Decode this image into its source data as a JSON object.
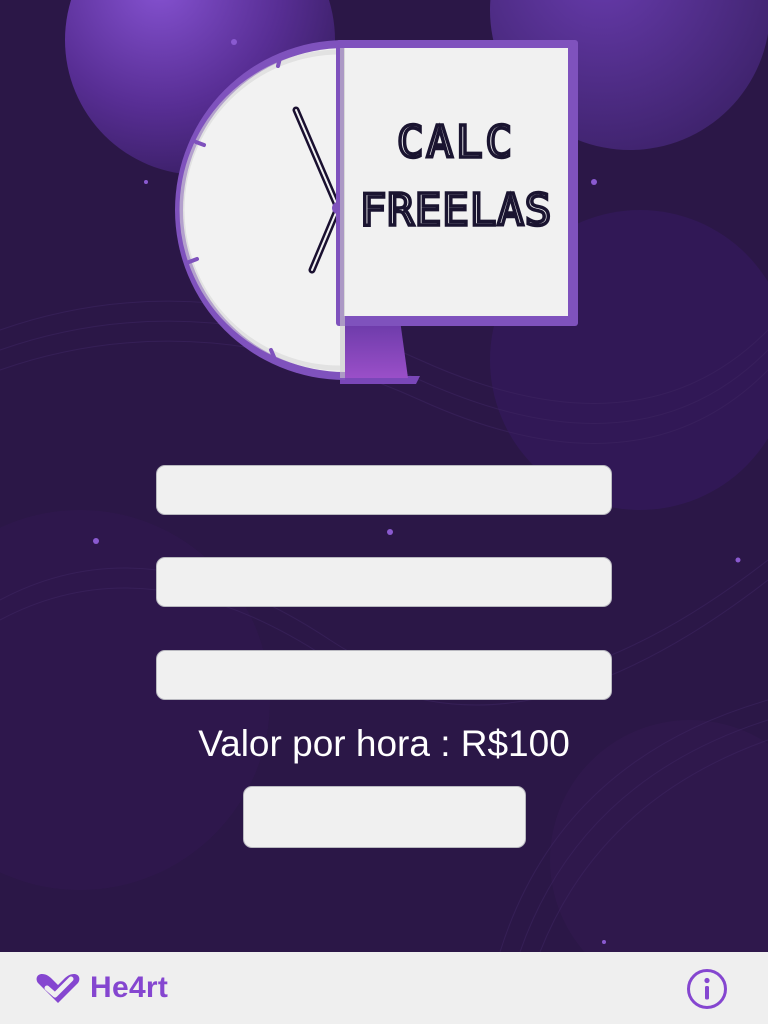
{
  "logo": {
    "line1": "CALC",
    "line2": "FREELAS"
  },
  "form": {
    "field_1_value": "",
    "field_2_value": "",
    "field_3_value": "",
    "rate_label": "Valor por hora : R$100",
    "submit_label": ""
  },
  "footer": {
    "brand": "He4rt",
    "info_icon": "info-icon",
    "brand_icon": "he4rt-logo-icon"
  },
  "colors": {
    "background": "#2b1747",
    "accent": "#7f4fc0",
    "brand": "#8546d0",
    "footer_bg": "#efefef",
    "field_bg": "#f0f0f0"
  }
}
